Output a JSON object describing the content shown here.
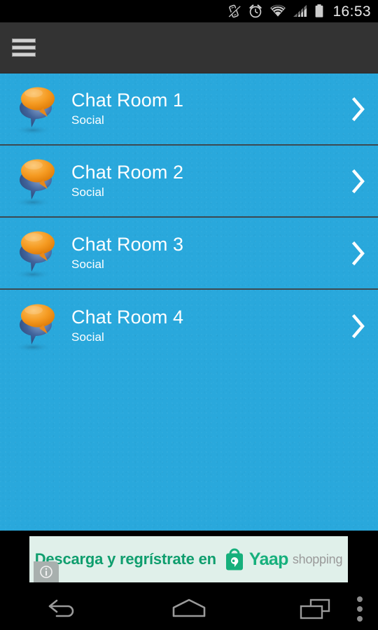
{
  "status_bar": {
    "time": "16:53",
    "icons": [
      {
        "name": "vibrate-icon",
        "label": "Vibrate"
      },
      {
        "name": "alarm-clock-icon",
        "label": "Alarm"
      },
      {
        "name": "wifi-icon",
        "label": "Wi-Fi"
      },
      {
        "name": "cellular-signal-icon",
        "label": "Signal"
      },
      {
        "name": "battery-icon",
        "label": "Battery"
      }
    ]
  },
  "action_bar": {
    "menu_label": "Menu",
    "title": "",
    "background": "#333333"
  },
  "list": {
    "background": "#29a8dc",
    "divider_color": "#3c4a52",
    "items": [
      {
        "title": "Chat Room 1",
        "subtitle": "Social",
        "icon": "chat-bubbles-icon",
        "chevron": "chevron-right-icon"
      },
      {
        "title": "Chat Room 2",
        "subtitle": "Social",
        "icon": "chat-bubbles-icon",
        "chevron": "chevron-right-icon"
      },
      {
        "title": "Chat Room 3",
        "subtitle": "Social",
        "icon": "chat-bubbles-icon",
        "chevron": "chevron-right-icon"
      },
      {
        "title": "Chat Room 4",
        "subtitle": "Social",
        "icon": "chat-bubbles-icon",
        "chevron": "chevron-right-icon"
      }
    ]
  },
  "ad": {
    "text": "Descarga y regrístrate en",
    "brand_name": "Yaap",
    "brand_suffix": "shopping",
    "bag_icon": "shopping-bag-icon",
    "info_icon": "info-icon",
    "text_color": "#0f9e6e",
    "brand_color": "#16b07c",
    "suffix_color": "#9a9a9a",
    "background": "#e0f0ea"
  },
  "nav_bar": {
    "buttons": [
      {
        "name": "back-button",
        "label": "Back"
      },
      {
        "name": "home-button",
        "label": "Home"
      },
      {
        "name": "recents-button",
        "label": "Recent apps"
      },
      {
        "name": "overflow-menu-button",
        "label": "More options"
      }
    ]
  },
  "icon_colors": {
    "bubble_orange_light": "#f7a93c",
    "bubble_orange_dark": "#e07d10",
    "bubble_blue_light": "#7290c0",
    "bubble_blue_dark": "#2b4c7e",
    "chevron": "#ffffff"
  }
}
